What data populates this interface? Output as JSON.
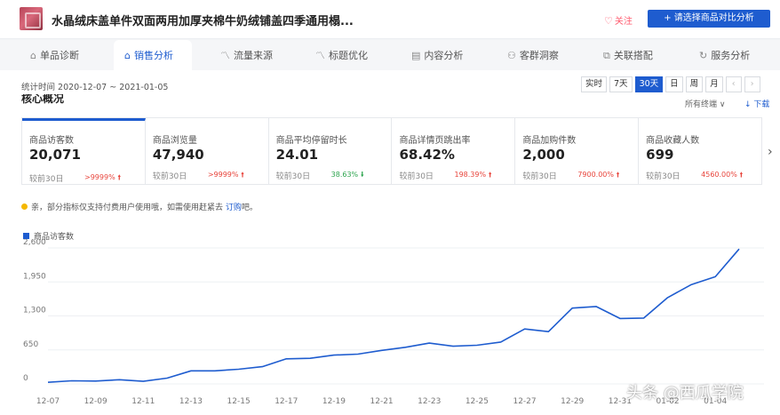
{
  "header": {
    "product_title": "水晶绒床盖单件双面两用加厚夹棉牛奶绒铺盖四季通用榻...",
    "follow_label": "关注",
    "compare_label": "+ 请选择商品对比分析",
    "colors": {
      "accent": "#1e5ccf"
    }
  },
  "tabs": [
    {
      "label": "单品诊断",
      "icon": "diagnosis-icon",
      "glyph": "⌂"
    },
    {
      "label": "销售分析",
      "icon": "sales-icon",
      "glyph": "⌂"
    },
    {
      "label": "流量来源",
      "icon": "traffic-icon",
      "glyph": "〽"
    },
    {
      "label": "标题优化",
      "icon": "title-icon",
      "glyph": "〽"
    },
    {
      "label": "内容分析",
      "icon": "content-icon",
      "glyph": "▤"
    },
    {
      "label": "客群洞察",
      "icon": "audience-icon",
      "glyph": "⚇"
    },
    {
      "label": "关联搭配",
      "icon": "match-icon",
      "glyph": "⧉"
    },
    {
      "label": "服务分析",
      "icon": "service-icon",
      "glyph": "↻"
    }
  ],
  "active_tab": 1,
  "main": {
    "stat_range": "统计时间 2020-12-07 ~ 2021-01-05",
    "periods": [
      "实时",
      "7天",
      "30天",
      "日",
      "周",
      "月"
    ],
    "active_period": "30天",
    "section_title": "核心概况",
    "all_channels": "所有终端 ∨",
    "download": "↓ 下载",
    "notice_prefix": "亲，部分指标仅支持付费用户使用哦，如需使用赶紧去 ",
    "notice_link": "订购",
    "notice_suffix": "吧。"
  },
  "metrics": [
    {
      "label": "商品访客数",
      "value": "20,071",
      "prev_label": "较前30日",
      "change": ">9999%",
      "trend": "up"
    },
    {
      "label": "商品浏览量",
      "value": "47,940",
      "prev_label": "较前30日",
      "change": ">9999%",
      "trend": "up"
    },
    {
      "label": "商品平均停留时长",
      "value": "24.01",
      "prev_label": "较前30日",
      "change": "38.63%",
      "trend": "down"
    },
    {
      "label": "商品详情页跳出率",
      "value": "68.42%",
      "prev_label": "较前30日",
      "change": "198.39%",
      "trend": "up"
    },
    {
      "label": "商品加购件数",
      "value": "2,000",
      "prev_label": "较前30日",
      "change": "7900.00%",
      "trend": "up"
    },
    {
      "label": "商品收藏人数",
      "value": "699",
      "prev_label": "较前30日",
      "change": "4560.00%",
      "trend": "up"
    }
  ],
  "chart_data": {
    "type": "line",
    "legend": "商品访客数",
    "series_color": "#1e5ccf",
    "y_ticks": [
      0,
      650,
      1300,
      1950,
      2600
    ],
    "y_tick_labels": [
      "0",
      "650",
      "1,300",
      "1,950",
      "2,600"
    ],
    "ylim": [
      0,
      2600
    ],
    "x_tick_labels": [
      "12-07",
      "12-09",
      "12-11",
      "12-13",
      "12-15",
      "12-17",
      "12-19",
      "12-21",
      "12-23",
      "12-25",
      "12-27",
      "12-29",
      "12-31",
      "01-02",
      "01-04"
    ],
    "x": [
      "12-07",
      "12-08",
      "12-09",
      "12-10",
      "12-11",
      "12-12",
      "12-13",
      "12-14",
      "12-15",
      "12-16",
      "12-17",
      "12-18",
      "12-19",
      "12-20",
      "12-21",
      "12-22",
      "12-23",
      "12-24",
      "12-25",
      "12-26",
      "12-27",
      "12-28",
      "12-29",
      "12-30",
      "12-31",
      "01-01",
      "01-02",
      "01-03",
      "01-04",
      "01-05"
    ],
    "values": [
      30,
      60,
      55,
      80,
      50,
      110,
      250,
      250,
      280,
      330,
      480,
      490,
      550,
      570,
      640,
      700,
      780,
      720,
      740,
      800,
      1050,
      1000,
      1450,
      1480,
      1250,
      1260,
      1650,
      1900,
      2050,
      2580
    ]
  },
  "watermark": "头条 @西瓜学院"
}
